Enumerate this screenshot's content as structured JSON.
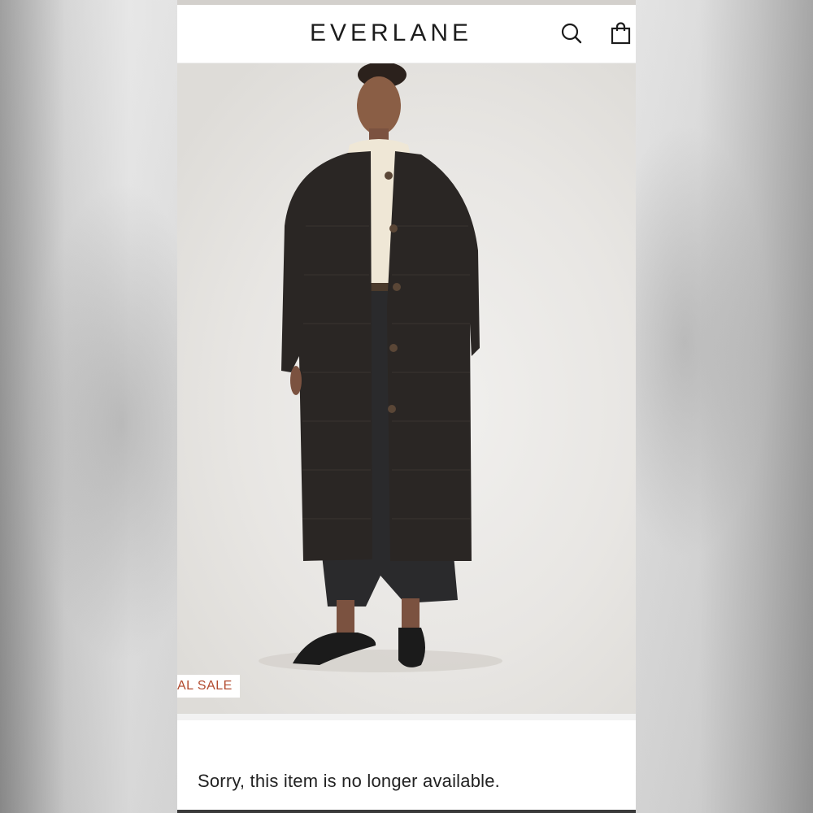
{
  "header": {
    "brand": "EVERLANE",
    "search_icon": "search-icon",
    "cart_icon": "shopping-bag-icon"
  },
  "product": {
    "badge_text": "AL SALE",
    "image_description_icon": "product-photo"
  },
  "message": {
    "text": "Sorry, this item is no longer available."
  },
  "colors": {
    "badge_text": "#b24a2e",
    "coat": "#2a2624",
    "sweater": "#efe7d6"
  }
}
